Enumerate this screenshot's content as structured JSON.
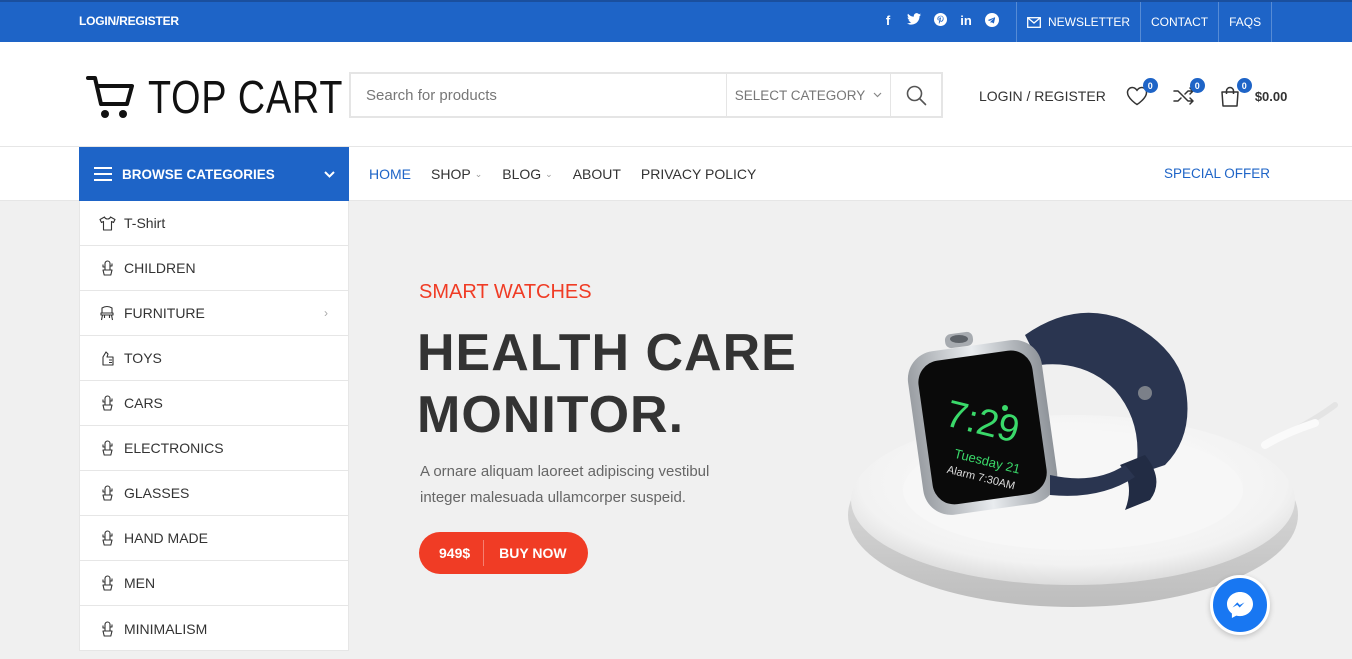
{
  "topbar": {
    "login": "LOGIN/REGISTER",
    "socials": [
      "f",
      "t",
      "p",
      "in",
      "tg"
    ],
    "links": {
      "newsletter": "NEWSLETTER",
      "contact": "CONTACT",
      "faqs": "FAQS"
    }
  },
  "header": {
    "logo": "TOP CART",
    "search": {
      "placeholder": "Search for products",
      "category": "SELECT CATEGORY"
    },
    "login_register": "LOGIN / REGISTER",
    "wishlist_count": "0",
    "compare_count": "0",
    "cart_count": "0",
    "cart_total": "$0.00"
  },
  "nav": {
    "browse": "BROWSE CATEGORIES",
    "items": [
      "HOME",
      "SHOP",
      "BLOG",
      "ABOUT",
      "PRIVACY POLICY"
    ],
    "special": "SPECIAL OFFER"
  },
  "categories": [
    "T-Shirt",
    "CHILDREN",
    "FURNITURE",
    "TOYS",
    "CARS",
    "ELECTRONICS",
    "GLASSES",
    "HAND MADE",
    "MEN",
    "MINIMALISM"
  ],
  "hero": {
    "subtitle": "SMART WATCHES",
    "line1": "HEALTH CARE",
    "line2": "MONITOR.",
    "desc1": "A ornare aliquam laoreet adipiscing vestibul",
    "desc2": "integer malesuada ullamcorper suspeid.",
    "price": "949$",
    "buy": "BUY NOW",
    "watch": {
      "time": "7:29",
      "day": "Tuesday 21",
      "alarm": "Alarm 7:30AM"
    }
  },
  "colors": {
    "brand": "#1e64c7",
    "accent": "#f03c25",
    "messenger": "#1877f2"
  }
}
